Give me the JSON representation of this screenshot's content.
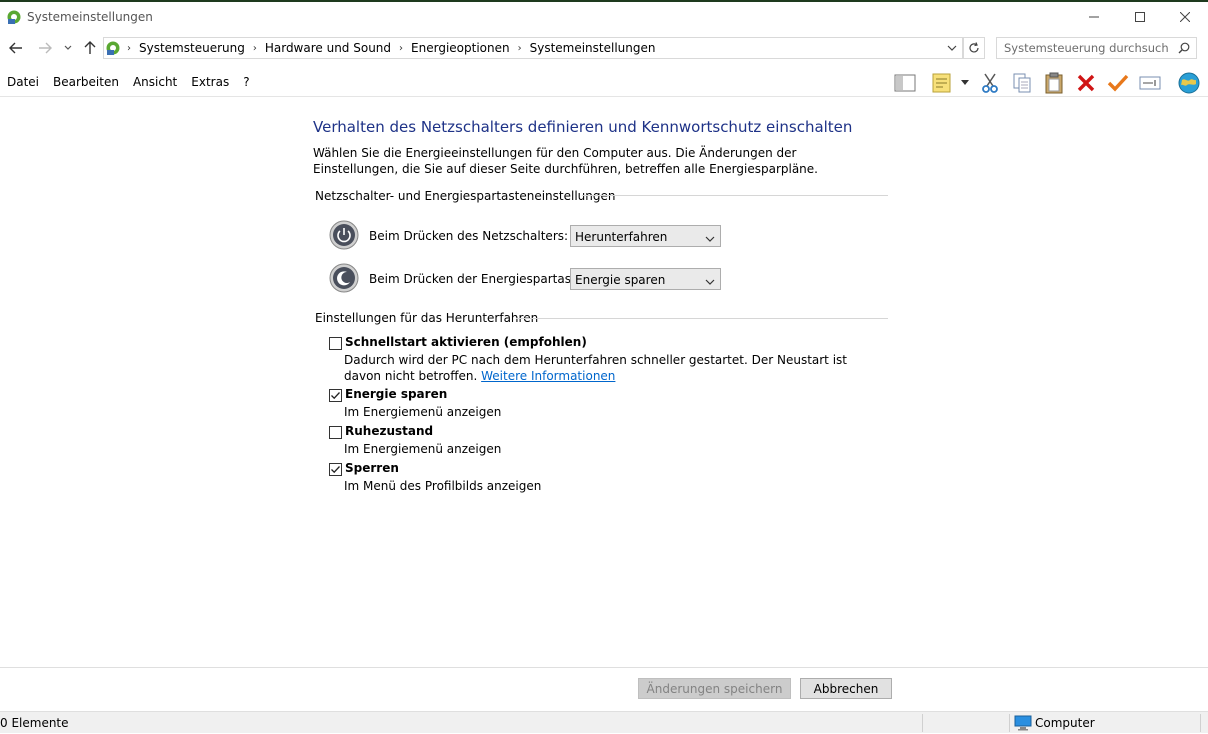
{
  "window": {
    "title": "Systemeinstellungen"
  },
  "address": {
    "crumbs": [
      "Systemsteuerung",
      "Hardware und Sound",
      "Energieoptionen",
      "Systemeinstellungen"
    ],
    "search_placeholder": "Systemsteuerung durchsuchen"
  },
  "menu": {
    "items": [
      "Datei",
      "Bearbeiten",
      "Ansicht",
      "Extras",
      "?"
    ]
  },
  "toolbar": {
    "icons": [
      "panel-icon",
      "notes-icon",
      "dropdown-arrow-icon",
      "cut-icon",
      "copy-icon",
      "paste-icon",
      "delete-icon",
      "check-icon",
      "rename-icon",
      "globe-icon"
    ]
  },
  "main": {
    "heading": "Verhalten des Netzschalters definieren und Kennwortschutz einschalten",
    "intro": "Wählen Sie die Energieeinstellungen für den Computer aus. Die Änderungen der Einstellungen, die Sie auf dieser Seite durchführen, betreffen alle Energiesparpläne.",
    "power_group": {
      "title": "Netzschalter- und Energiespartasteneinstellungen",
      "rows": [
        {
          "label": "Beim Drücken des Netzschalters:",
          "value": "Herunterfahren"
        },
        {
          "label": "Beim Drücken der Energiespartaste:",
          "value": "Energie sparen"
        }
      ]
    },
    "shutdown_group": {
      "title": "Einstellungen für das Herunterfahren",
      "options": [
        {
          "label": "Schnellstart aktivieren (empfohlen)",
          "checked": false,
          "description": "Dadurch wird der PC nach dem Herunterfahren schneller gestartet. Der Neustart ist davon nicht betroffen.",
          "link": "Weitere Informationen"
        },
        {
          "label": "Energie sparen",
          "checked": true,
          "description": "Im Energiemenü anzeigen"
        },
        {
          "label": "Ruhezustand",
          "checked": false,
          "description": "Im Energiemenü anzeigen"
        },
        {
          "label": "Sperren",
          "checked": true,
          "description": "Im Menü des Profilbilds anzeigen"
        }
      ]
    }
  },
  "buttons": {
    "save": "Änderungen speichern",
    "cancel": "Abbrechen"
  },
  "statusbar": {
    "count": "0 Elemente",
    "location": "Computer"
  }
}
